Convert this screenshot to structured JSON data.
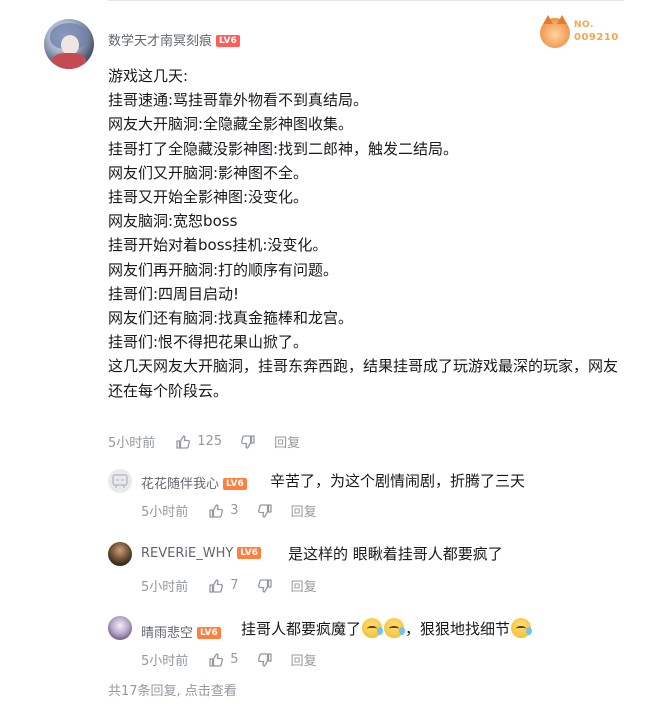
{
  "comment": {
    "username": "数学天才南冥刻痕",
    "level": "LV6",
    "badge": {
      "label": "NO.",
      "number": "009210"
    },
    "lines": [
      "游戏这几天:",
      "挂哥速通:骂挂哥靠外物看不到真结局。",
      "网友大开脑洞:全隐藏全影神图收集。",
      "挂哥打了全隐藏没影神图:找到二郎神，触发二结局。",
      "网友们又开脑洞:影神图不全。",
      "挂哥又开始全影神图:没变化。",
      "网友脑洞:宽恕boss",
      "挂哥开始对着boss挂机:没变化。",
      "网友们再开脑洞:打的顺序有问题。",
      "挂哥们:四周目启动!",
      "网友们还有脑洞:找真金箍棒和龙宫。",
      "挂哥们:恨不得把花果山掀了。",
      "这几天网友大开脑洞，挂哥东奔西跑，结果挂哥成了玩游戏最深的玩家，网友还在每个阶段云。"
    ],
    "time": "5小时前",
    "likes": "125",
    "reply_label": "回复"
  },
  "replies": [
    {
      "username": "花花随伴我心",
      "level": "LV6",
      "text": "辛苦了，为这个剧情闹剧，折腾了三天",
      "time": "5小时前",
      "likes": "3",
      "reply_label": "回复"
    },
    {
      "username": "REVERiE_WHY",
      "level": "LV6",
      "text": "是这样的 眼瞅着挂哥人都要疯了",
      "time": "5小时前",
      "likes": "7",
      "reply_label": "回复"
    },
    {
      "username": "晴雨悲空",
      "level": "LV6",
      "text_before": "挂哥人都要疯魔了",
      "text_after": "，狠狠地找细节",
      "emoji_name": "cry-laugh-emoji",
      "time": "5小时前",
      "likes": "5",
      "reply_label": "回复"
    }
  ],
  "footer": {
    "more_text": "共17条回复, 点击查看"
  },
  "colors": {
    "text": "#18191c",
    "muted": "#9499a0",
    "name": "#61666d",
    "level": "#ff5c5c",
    "badge": "#f2a74e",
    "link": "#00aeec"
  }
}
